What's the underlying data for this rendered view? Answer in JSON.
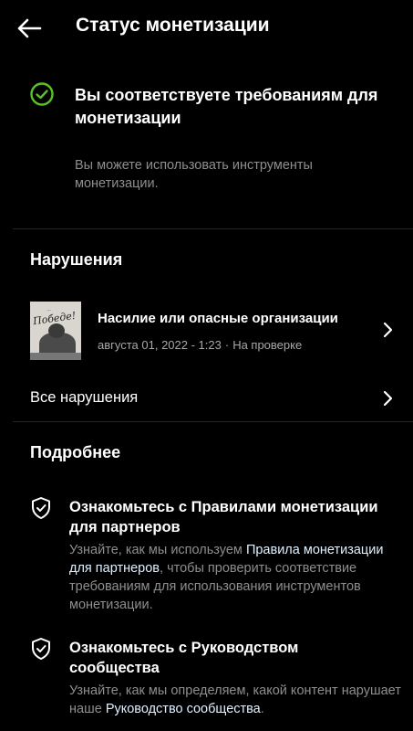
{
  "header": {
    "title": "Статус монетизации",
    "back_icon": "arrow-left-icon"
  },
  "status": {
    "icon": "check-circle-icon",
    "icon_color": "#58c322",
    "title": "Вы соответствуете требованиям для монетизации",
    "description": "Вы можете использовать инструменты монетизации."
  },
  "violations": {
    "section_title": "Нарушения",
    "items": [
      {
        "thumbnail_text": "Победе!",
        "title": "Насилие или опасные организации",
        "date": "августа 01, 2022 - 1:23",
        "separator": "·",
        "status": "На проверке"
      }
    ],
    "all_label": "Все нарушения"
  },
  "more": {
    "section_title": "Подробнее",
    "items": [
      {
        "icon": "shield-check-icon",
        "title": "Ознакомьтесь с Правилами монетизации для партнеров",
        "desc_before": "Узнайте, как мы используем ",
        "desc_link": "Правила монетизации для партнеров",
        "desc_after": ", чтобы проверить соответствие требованиям для использования инструментов монетизации."
      },
      {
        "icon": "shield-check-icon",
        "title": "Ознакомьтесь с Руководством сообщества",
        "desc_before": "Узнайте, как мы определяем, какой контент нарушает наше ",
        "desc_link": "Руководство сообщества",
        "desc_after": "."
      }
    ]
  }
}
